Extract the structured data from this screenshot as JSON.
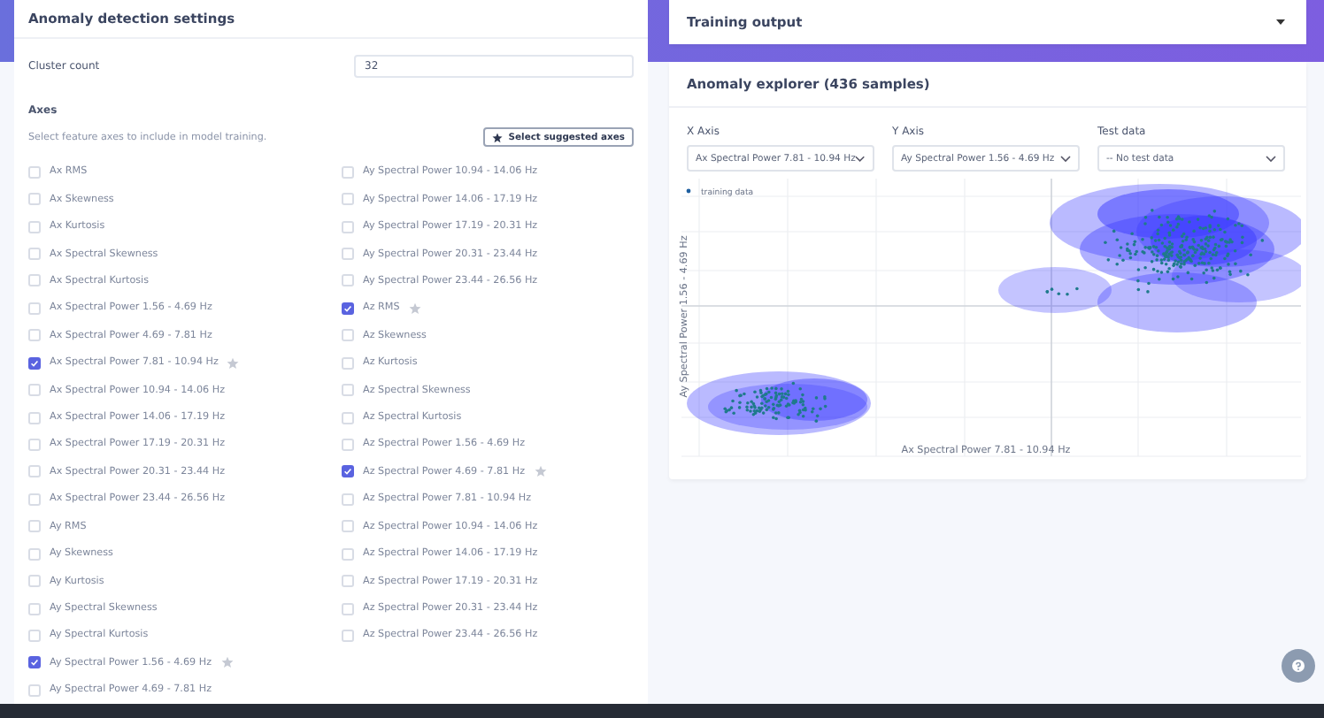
{
  "settings": {
    "title": "Anomaly detection settings",
    "cluster_count": {
      "label": "Cluster count",
      "value": "32"
    },
    "axes": {
      "heading": "Axes",
      "help": "Select feature axes to include in model training.",
      "suggest_button": "Select suggested axes",
      "left_column": [
        {
          "label": "Ax RMS",
          "checked": false,
          "suggested": false
        },
        {
          "label": "Ax Skewness",
          "checked": false,
          "suggested": false
        },
        {
          "label": "Ax Kurtosis",
          "checked": false,
          "suggested": false
        },
        {
          "label": "Ax Spectral Skewness",
          "checked": false,
          "suggested": false
        },
        {
          "label": "Ax Spectral Kurtosis",
          "checked": false,
          "suggested": false
        },
        {
          "label": "Ax Spectral Power 1.56 - 4.69 Hz",
          "checked": false,
          "suggested": false
        },
        {
          "label": "Ax Spectral Power 4.69 - 7.81 Hz",
          "checked": false,
          "suggested": false
        },
        {
          "label": "Ax Spectral Power 7.81 - 10.94 Hz",
          "checked": true,
          "suggested": true
        },
        {
          "label": "Ax Spectral Power 10.94 - 14.06 Hz",
          "checked": false,
          "suggested": false
        },
        {
          "label": "Ax Spectral Power 14.06 - 17.19 Hz",
          "checked": false,
          "suggested": false
        },
        {
          "label": "Ax Spectral Power 17.19 - 20.31 Hz",
          "checked": false,
          "suggested": false
        },
        {
          "label": "Ax Spectral Power 20.31 - 23.44 Hz",
          "checked": false,
          "suggested": false
        },
        {
          "label": "Ax Spectral Power 23.44 - 26.56 Hz",
          "checked": false,
          "suggested": false
        },
        {
          "label": "Ay RMS",
          "checked": false,
          "suggested": false
        },
        {
          "label": "Ay Skewness",
          "checked": false,
          "suggested": false
        },
        {
          "label": "Ay Kurtosis",
          "checked": false,
          "suggested": false
        },
        {
          "label": "Ay Spectral Skewness",
          "checked": false,
          "suggested": false
        },
        {
          "label": "Ay Spectral Kurtosis",
          "checked": false,
          "suggested": false
        },
        {
          "label": "Ay Spectral Power 1.56 - 4.69 Hz",
          "checked": true,
          "suggested": true
        },
        {
          "label": "Ay Spectral Power 4.69 - 7.81 Hz",
          "checked": false,
          "suggested": false
        }
      ],
      "right_column": [
        {
          "label": "Ay Spectral Power 10.94 - 14.06 Hz",
          "checked": false,
          "suggested": false
        },
        {
          "label": "Ay Spectral Power 14.06 - 17.19 Hz",
          "checked": false,
          "suggested": false
        },
        {
          "label": "Ay Spectral Power 17.19 - 20.31 Hz",
          "checked": false,
          "suggested": false
        },
        {
          "label": "Ay Spectral Power 20.31 - 23.44 Hz",
          "checked": false,
          "suggested": false
        },
        {
          "label": "Ay Spectral Power 23.44 - 26.56 Hz",
          "checked": false,
          "suggested": false
        },
        {
          "label": "Az RMS",
          "checked": true,
          "suggested": true
        },
        {
          "label": "Az Skewness",
          "checked": false,
          "suggested": false
        },
        {
          "label": "Az Kurtosis",
          "checked": false,
          "suggested": false
        },
        {
          "label": "Az Spectral Skewness",
          "checked": false,
          "suggested": false
        },
        {
          "label": "Az Spectral Kurtosis",
          "checked": false,
          "suggested": false
        },
        {
          "label": "Az Spectral Power 1.56 - 4.69 Hz",
          "checked": false,
          "suggested": false
        },
        {
          "label": "Az Spectral Power 4.69 - 7.81 Hz",
          "checked": true,
          "suggested": true
        },
        {
          "label": "Az Spectral Power 7.81 - 10.94 Hz",
          "checked": false,
          "suggested": false
        },
        {
          "label": "Az Spectral Power 10.94 - 14.06 Hz",
          "checked": false,
          "suggested": false
        },
        {
          "label": "Az Spectral Power 14.06 - 17.19 Hz",
          "checked": false,
          "suggested": false
        },
        {
          "label": "Az Spectral Power 17.19 - 20.31 Hz",
          "checked": false,
          "suggested": false
        },
        {
          "label": "Az Spectral Power 20.31 - 23.44 Hz",
          "checked": false,
          "suggested": false
        },
        {
          "label": "Az Spectral Power 23.44 - 26.56 Hz",
          "checked": false,
          "suggested": false
        }
      ]
    }
  },
  "training_output": {
    "title": "Training output",
    "expanded": false
  },
  "explorer": {
    "title": "Anomaly explorer (436 samples)",
    "selects": [
      {
        "label": "X Axis",
        "value": "Ax Spectral Power 7.81 - 10.94 Hz"
      },
      {
        "label": "Y Axis",
        "value": "Ay Spectral Power 1.56 - 4.69 Hz"
      },
      {
        "label": "Test data",
        "value": "-- No test data"
      }
    ],
    "legend": "training data",
    "xlabel": "Ax Spectral Power 7.81 - 10.94 Hz",
    "ylabel": "Ay Spectral Power 1.56 - 4.69 Hz"
  }
}
